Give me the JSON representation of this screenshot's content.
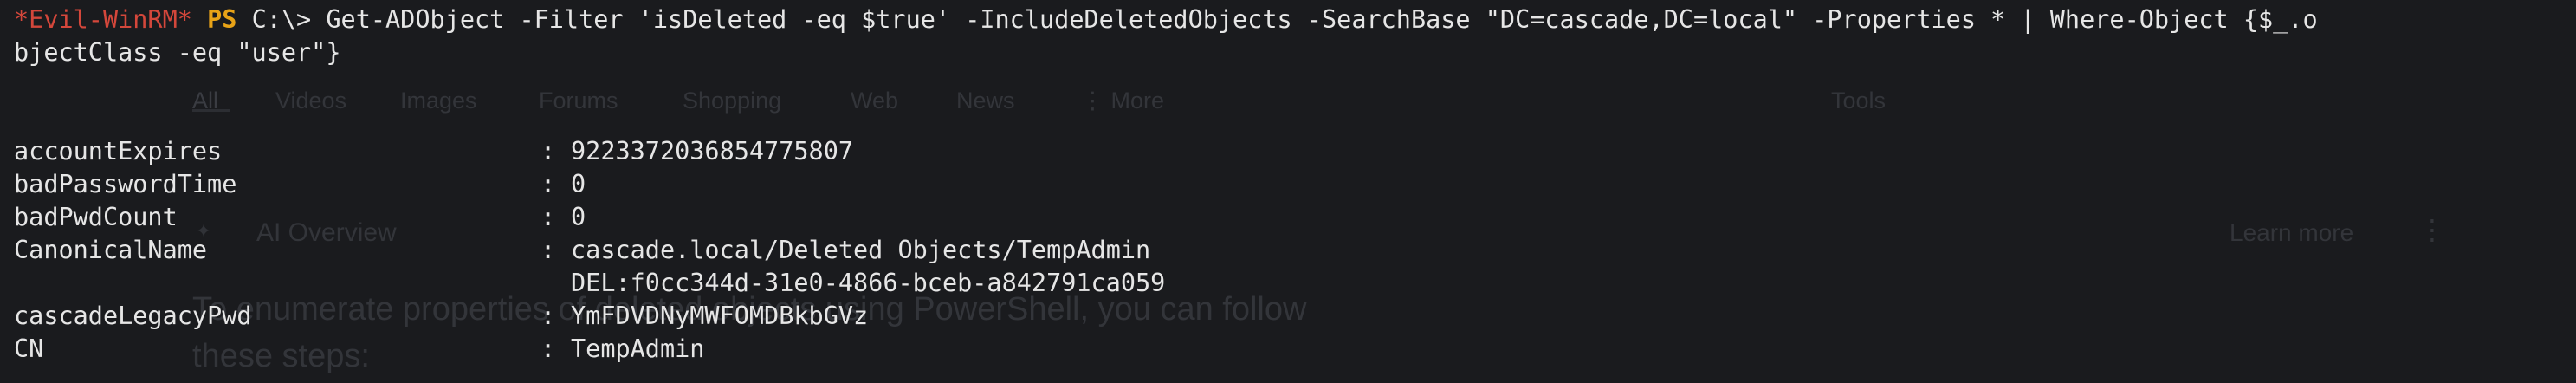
{
  "prompt": {
    "host": "*Evil-WinRM*",
    "shell": "PS",
    "path": "C:\\>",
    "command_line1": "Get-ADObject -Filter 'isDeleted -eq $true' -IncludeDeletedObjects -SearchBase \"DC=cascade,DC=local\" -Properties * | Where-Object {$_.o",
    "command_line2": "bjectClass -eq \"user\"}"
  },
  "separator": ":",
  "properties": [
    {
      "key": "accountExpires",
      "value": "9223372036854775807"
    },
    {
      "key": "badPasswordTime",
      "value": "0"
    },
    {
      "key": "badPwdCount",
      "value": "0"
    },
    {
      "key": "CanonicalName",
      "value": "cascade.local/Deleted Objects/TempAdmin",
      "value2": "DEL:f0cc344d-31e0-4866-bceb-a842791ca059"
    },
    {
      "key": "cascadeLegacyPwd",
      "value": "YmFDVDNyMWFOMDBkbGVz"
    },
    {
      "key": "CN",
      "value": "TempAdmin"
    }
  ],
  "ghost": {
    "tabs": [
      "All",
      "Videos",
      "Images",
      "Forums",
      "Shopping",
      "Web",
      "News",
      "⋮ More"
    ],
    "tools": "Tools",
    "ai_overview": "AI Overview",
    "learn_more": "Learn more",
    "dots": "⋮",
    "body_line1": "To enumerate properties of deleted objects using PowerShell, you can follow",
    "body_line2": "these steps:"
  }
}
